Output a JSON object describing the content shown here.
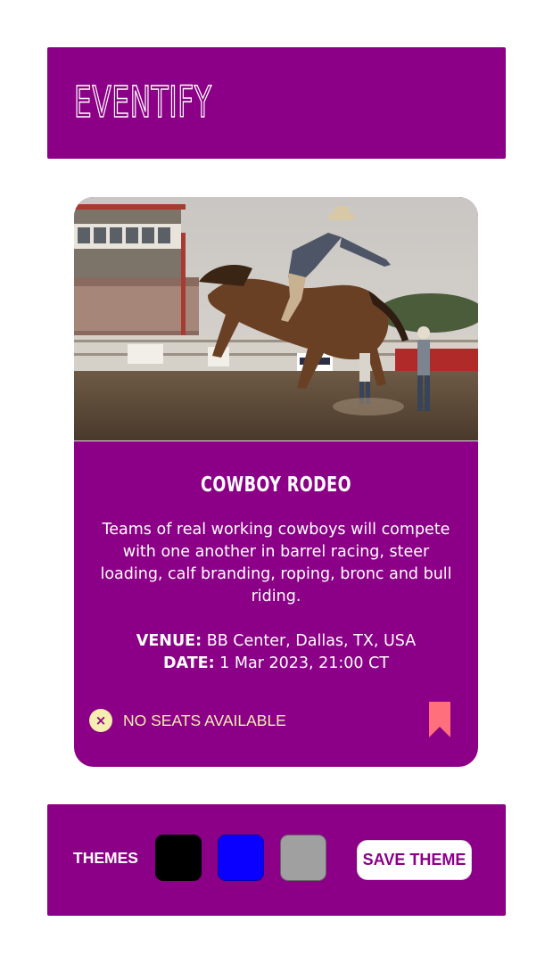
{
  "app": {
    "title": "EVENTIFY"
  },
  "event": {
    "image_alt": "Cowboy riding a bucking bronc horse in a rodeo arena",
    "title": "COWBOY RODEO",
    "description": "Teams of real working cowboys will compete with one another in  barrel racing, steer loading, calf branding, roping, bronc and bull riding.",
    "venue_label": "VENUE:",
    "venue": "BB Center, Dallas, TX, USA",
    "date_label": "DATE:",
    "date": "1 Mar 2023, 21:00 CT",
    "status_icon": "×",
    "status": "NO SEATS AVAILABLE",
    "bookmark_icon": "bookmark-icon"
  },
  "themes": {
    "label": "THEMES",
    "swatches": [
      {
        "name": "black",
        "color": "#000000"
      },
      {
        "name": "blue",
        "color": "#0a00ff"
      },
      {
        "name": "gray",
        "color": "#a0a0a0"
      }
    ],
    "save_label": "SAVE THEME"
  },
  "colors": {
    "primary": "#8b0086",
    "accent": "#f5eeb0",
    "bookmark": "#ff6f7c"
  }
}
